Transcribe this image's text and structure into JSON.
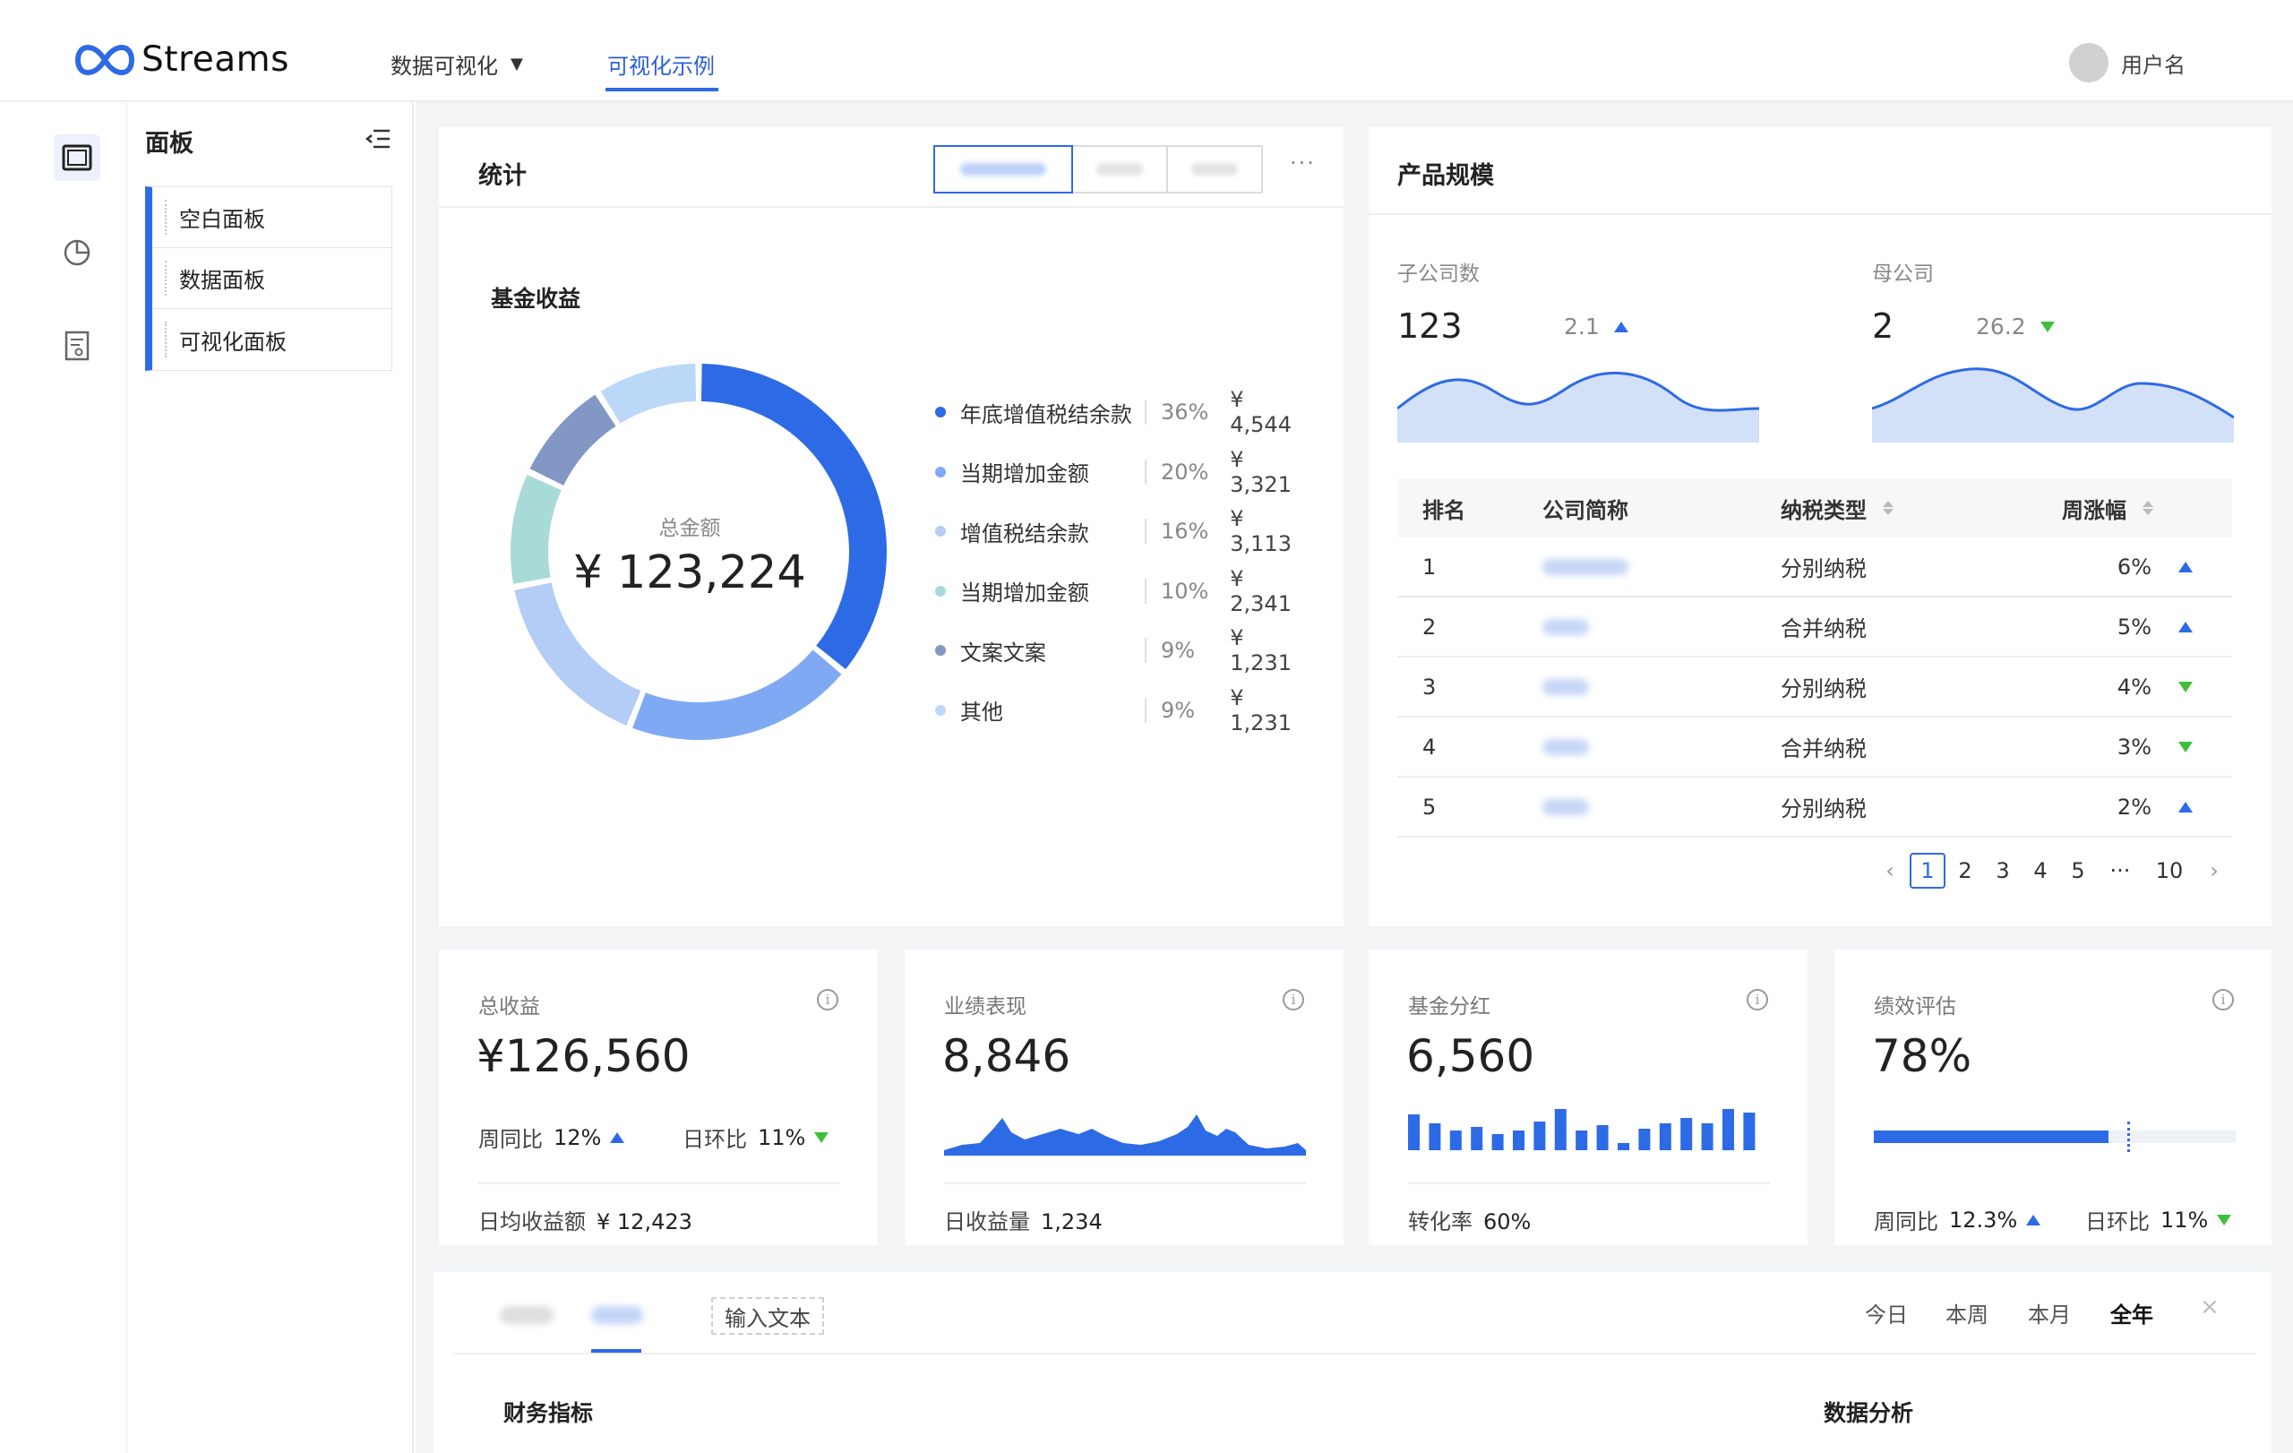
{
  "header": {
    "brand": "Streams",
    "nav": [
      {
        "label": "数据可视化",
        "has_dropdown": true
      },
      {
        "label": "可视化示例",
        "active": true
      }
    ],
    "user_name": "用户名"
  },
  "rail": {
    "icons": [
      "dashboard-icon",
      "pie-chart-icon",
      "report-icon"
    ]
  },
  "sidebar": {
    "title": "面板",
    "items": [
      {
        "label": "空白面板"
      },
      {
        "label": "数据面板"
      },
      {
        "label": "可视化面板"
      }
    ]
  },
  "stats": {
    "title": "统计",
    "section_title": "基金收益",
    "center_label": "总金额",
    "center_value": "¥ 123,224",
    "legend": [
      {
        "name": "年底增值税结余款",
        "pct": "36%",
        "value": "¥ 4,544",
        "color": "#2d6ae6"
      },
      {
        "name": "当期增加金额",
        "pct": "20%",
        "value": "¥ 3,321",
        "color": "#7fa9f3"
      },
      {
        "name": "增值税结余款",
        "pct": "16%",
        "value": "¥ 3,113",
        "color": "#b3cdf6"
      },
      {
        "name": "当期增加金额",
        "pct": "10%",
        "value": "¥ 2,341",
        "color": "#a8dbd8"
      },
      {
        "name": "文案文案",
        "pct": "9%",
        "value": "¥ 1,231",
        "color": "#8397c4"
      },
      {
        "name": "其他",
        "pct": "9%",
        "value": "¥ 1,231",
        "color": "#bcd8f8"
      }
    ]
  },
  "chart_data": {
    "type": "pie",
    "donut": true,
    "categories": [
      "年底增值税结余款",
      "当期增加金额",
      "增值税结余款",
      "当期增加金额",
      "文案文案",
      "其他"
    ],
    "values": [
      36,
      20,
      16,
      10,
      9,
      9
    ],
    "colors": [
      "#2d6ae6",
      "#7fa9f3",
      "#b3cdf6",
      "#a8dbd8",
      "#8397c4",
      "#bcd8f8"
    ]
  },
  "product": {
    "title": "产品规模",
    "kpis": [
      {
        "label": "子公司数",
        "value": "123",
        "change": "2.1",
        "trend": "up"
      },
      {
        "label": "母公司",
        "value": "2",
        "change": "26.2",
        "trend": "down"
      }
    ],
    "table": {
      "headers": [
        "排名",
        "公司简称",
        "纳税类型",
        "周涨幅"
      ],
      "rows": [
        {
          "rank": "1",
          "tax": "分别纳税",
          "change": "6%",
          "trend": "up"
        },
        {
          "rank": "2",
          "tax": "合并纳税",
          "change": "5%",
          "trend": "up"
        },
        {
          "rank": "3",
          "tax": "分别纳税",
          "change": "4%",
          "trend": "down"
        },
        {
          "rank": "4",
          "tax": "合并纳税",
          "change": "3%",
          "trend": "down"
        },
        {
          "rank": "5",
          "tax": "分别纳税",
          "change": "2%",
          "trend": "up"
        }
      ]
    },
    "pagination": {
      "pages": [
        "1",
        "2",
        "3",
        "4",
        "5",
        "···",
        "10"
      ],
      "current": "1"
    }
  },
  "metrics": [
    {
      "label": "总收益",
      "value": "¥126,560",
      "sub": [
        {
          "label": "周同比",
          "value": "12%",
          "trend": "up"
        },
        {
          "label": "日环比",
          "value": "11%",
          "trend": "down"
        }
      ],
      "foot_label": "日均收益额",
      "foot_value": "¥ 12,423"
    },
    {
      "label": "业绩表现",
      "value": "8,846",
      "foot_label": "日收益量",
      "foot_value": "1,234"
    },
    {
      "label": "基金分红",
      "value": "6,560",
      "foot_label": "转化率",
      "foot_value": "60%"
    },
    {
      "label": "绩效评估",
      "value": "78%",
      "progress": 0.78,
      "sub": [
        {
          "label": "周同比",
          "value": "12.3%",
          "trend": "up"
        },
        {
          "label": "日环比",
          "value": "11%",
          "trend": "down"
        }
      ]
    }
  ],
  "bottom": {
    "input_tag": "输入文本",
    "ranges": [
      {
        "label": "今日"
      },
      {
        "label": "本周"
      },
      {
        "label": "本月"
      },
      {
        "label": "全年",
        "active": true
      }
    ],
    "close": "×",
    "left_title": "财务指标",
    "right_title": "数据分析"
  },
  "colors": {
    "accent": "#2d6ae6",
    "up": "#2d6ae6",
    "down": "#3cc03c"
  }
}
